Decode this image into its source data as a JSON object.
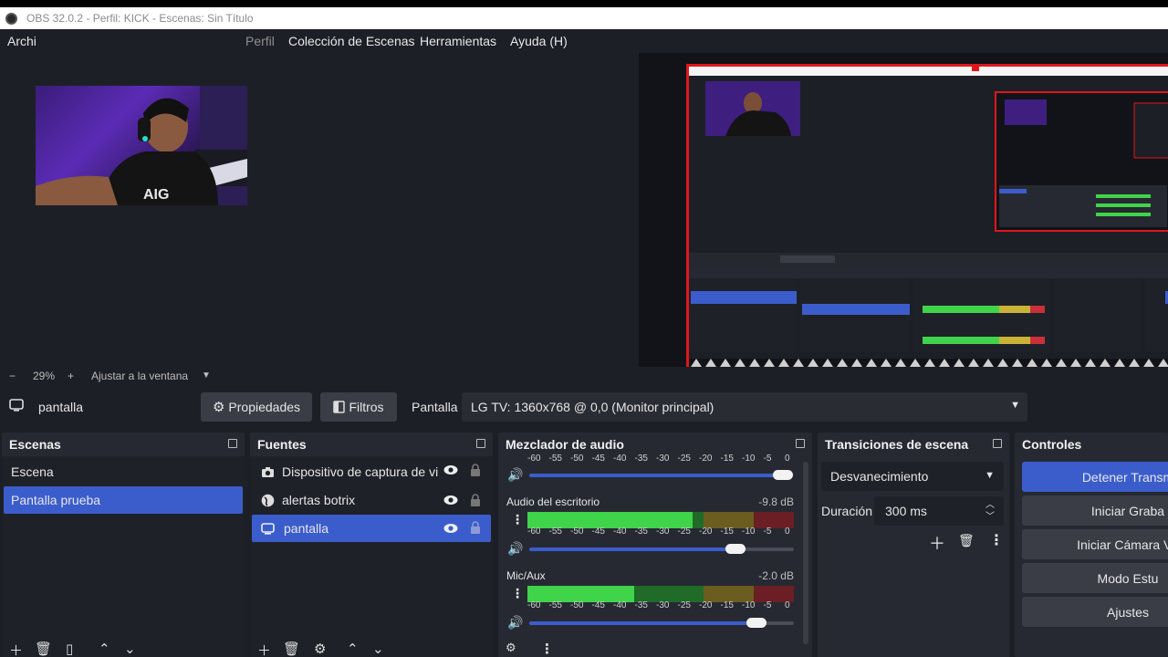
{
  "window": {
    "title": "OBS 32.0.2 - Perfil: KICK - Escenas: Sin Título"
  },
  "menu": {
    "file_partial": "Archi",
    "profile_partial": "Perfil",
    "scene_collection": "Colección de Escenas",
    "tools": "Herramientas",
    "help": "Ayuda (H)"
  },
  "zoom": {
    "minus": "−",
    "level": "29%",
    "plus": "+",
    "fit": "Ajustar a la ventana"
  },
  "source_toolbar": {
    "source_name": "pantalla",
    "properties_label": "Propiedades",
    "filters_label": "Filtros",
    "display_label": "Pantalla",
    "display_value": "LG TV: 1360x768 @ 0,0 (Monitor principal)"
  },
  "scenes": {
    "title": "Escenas",
    "items": [
      {
        "label": "Escena",
        "selected": false
      },
      {
        "label": "Pantalla prueba",
        "selected": true
      }
    ]
  },
  "sources": {
    "title": "Fuentes",
    "items": [
      {
        "label": "Dispositivo de captura de vi",
        "icon": "camera-icon",
        "selected": false
      },
      {
        "label": "alertas botrix",
        "icon": "globe-icon",
        "selected": false
      },
      {
        "label": "pantalla",
        "icon": "monitor-icon",
        "selected": true
      }
    ]
  },
  "mixer": {
    "title": "Mezclador de audio",
    "ticks": [
      "-60",
      "-55",
      "-50",
      "-45",
      "-40",
      "-35",
      "-30",
      "-25",
      "-20",
      "-15",
      "-10",
      "-5",
      "0"
    ],
    "channels": [
      {
        "name": "Audio del escritorio",
        "db": "-9.8 dB",
        "level": 0.62,
        "volume": 0.78
      },
      {
        "name": "Mic/Aux",
        "db": "-2.0 dB",
        "level": 0.4,
        "volume": 0.86
      }
    ],
    "top_volume": 0.96
  },
  "transitions": {
    "title": "Transiciones de escena",
    "selected": "Desvanecimiento",
    "duration_label": "Duración",
    "duration_value": "300 ms"
  },
  "controls": {
    "title": "Controles",
    "buttons": [
      "Detener Transm",
      "Iniciar Graba",
      "Iniciar Cámara Vir",
      "Modo Estu",
      "Ajustes"
    ]
  },
  "colors": {
    "accent": "#3b5dcc",
    "panel": "#272932",
    "background": "#1d1f26",
    "meter_green": "#3fd44a",
    "meter_yellow": "#c9b236",
    "meter_red": "#c9303a"
  }
}
